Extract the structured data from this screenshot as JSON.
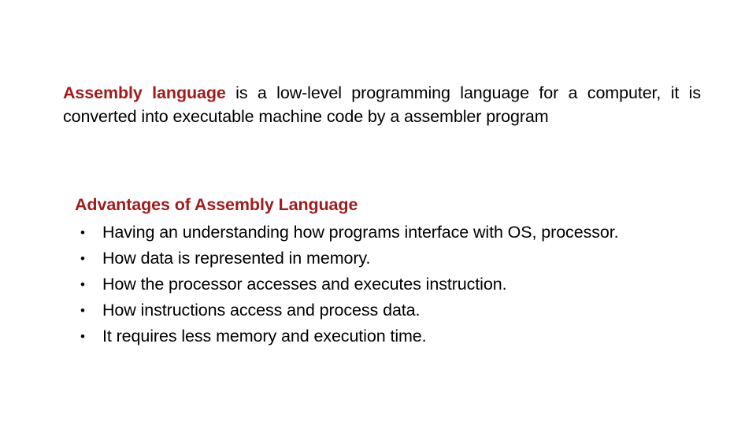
{
  "slide": {
    "background_color": "#FFFFFF",
    "body_text_color": "#000000",
    "accent_color": "#A01C1C",
    "intro": {
      "emphasis": "Assembly language",
      "rest": " is a low-level programming language for a computer, it is converted into executable machine code by a assembler program"
    },
    "advantages": {
      "heading": "Advantages of Assembly Language",
      "bullet_glyph": "•",
      "items": [
        "Having an understanding how programs interface with OS, processor.",
        "How data is represented in memory.",
        "How the processor accesses and executes instruction.",
        "How instructions access and process data.",
        "It requires less memory and execution time."
      ]
    }
  }
}
